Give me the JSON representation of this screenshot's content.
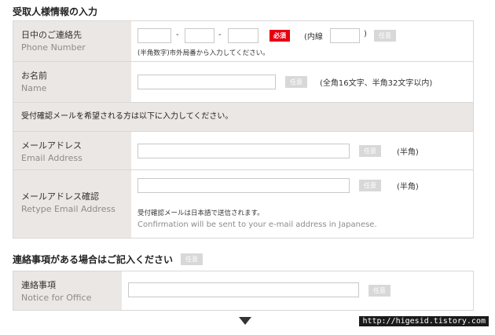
{
  "section1": {
    "title": "受取人様情報の入力"
  },
  "phone": {
    "label_jp": "日中のご連絡先",
    "label_en": "Phone Number",
    "dash": "-",
    "required": "必須",
    "ext_open": "(内線",
    "ext_close": ")",
    "optional": "任意",
    "hint": "(半角数字)市外局番から入力してください。"
  },
  "name": {
    "label_jp": "お名前",
    "label_en": "Name",
    "optional": "任意",
    "hint": "(全角16文字、半角32文字以内)"
  },
  "notice": {
    "text": "受付確認メールを希望される方は以下に入力してください。"
  },
  "email": {
    "label_jp": "メールアドレス",
    "label_en": "Email Address",
    "optional": "任意",
    "hint": "(半角)"
  },
  "email_confirm": {
    "label_jp": "メールアドレス確認",
    "label_en": "Retype Email Address",
    "optional": "任意",
    "hint": "(半角)",
    "note_jp": "受付確認メールは日本語で送信されます。",
    "note_en": "Confirmation will be sent to your e-mail address in Japanese."
  },
  "section2": {
    "title": "連絡事項がある場合はご記入ください",
    "optional": "任意"
  },
  "office": {
    "label_jp": "連絡事項",
    "label_en": "Notice for Office",
    "optional": "任意"
  },
  "watermark": {
    "text": "http://higesid.tistory.com"
  }
}
